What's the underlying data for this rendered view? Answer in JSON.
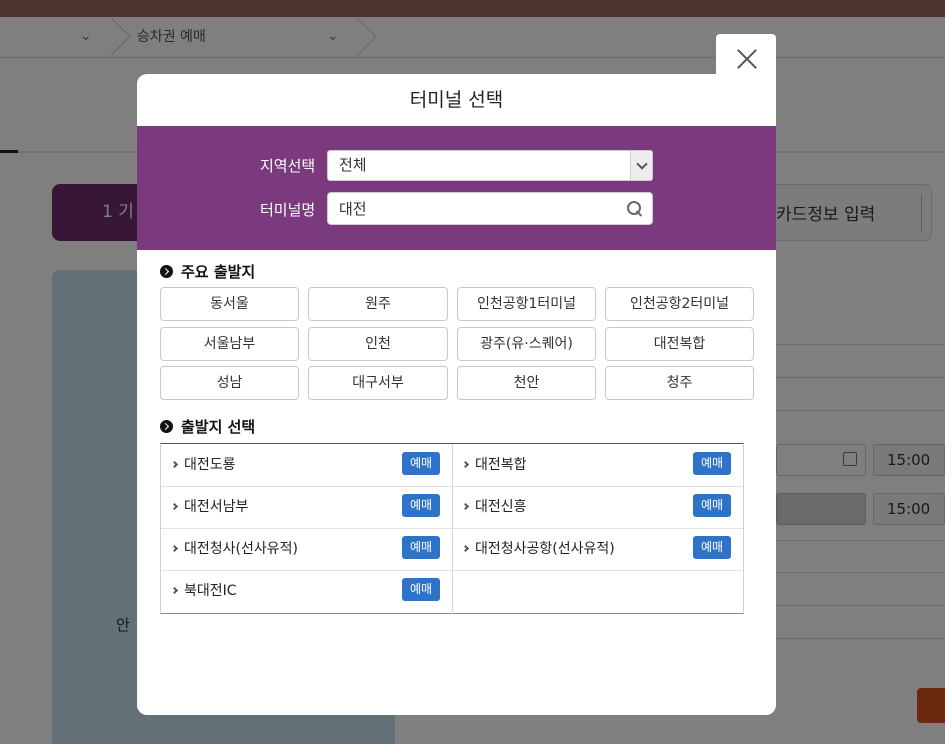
{
  "background": {
    "breadcrumb": {
      "current": "승차권 예매"
    },
    "steps": {
      "active": "1 기",
      "last": "카드정보 입력"
    },
    "left_panel_text": "안",
    "times": [
      "15:00",
      "15:00"
    ]
  },
  "modal": {
    "title": "터미널 선택",
    "region_label": "지역선택",
    "region_value": "전체",
    "terminal_label": "터미널명",
    "terminal_value": "대전",
    "major_section_title": "주요 출발지",
    "major_terminals": [
      "동서울",
      "원주",
      "인천공항1터미널",
      "인천공항2터미널",
      "서울남부",
      "인천",
      "광주(유·스퀘어)",
      "대전복합",
      "성남",
      "대구서부",
      "천안",
      "청주"
    ],
    "departure_section_title": "출발지 선택",
    "departures": [
      {
        "name": "대전도룡",
        "button": "예매"
      },
      {
        "name": "대전복합",
        "button": "예매"
      },
      {
        "name": "대전서남부",
        "button": "예매"
      },
      {
        "name": "대전신흥",
        "button": "예매"
      },
      {
        "name": "대전청사(선사유적)",
        "button": "예매"
      },
      {
        "name": "대전청사공항(선사유적)",
        "button": "예매"
      },
      {
        "name": "북대전IC",
        "button": "예매"
      }
    ]
  },
  "colors": {
    "header_purple": "#7a3a7d",
    "reserve_blue": "#2f73c9"
  }
}
